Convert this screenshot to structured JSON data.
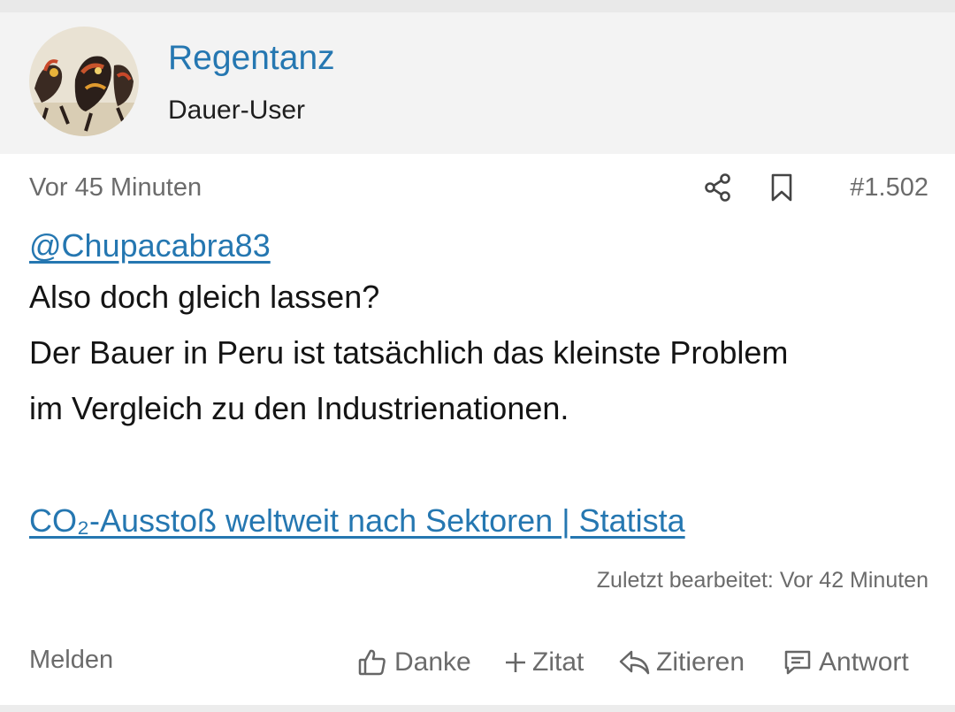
{
  "user": {
    "name": "Regentanz",
    "title": "Dauer-User"
  },
  "post": {
    "time": "Vor 45 Minuten",
    "number": "#1.502",
    "mention": "@Chupacabra83",
    "lines": [
      "Also doch gleich lassen?",
      "Der Bauer in Peru ist tatsächlich das kleinste Problem",
      "im Vergleich zu den Industrienationen."
    ],
    "link_text": "CO₂-Ausstoß weltweit nach Sektoren | Statista",
    "edited": "Zuletzt bearbeitet: Vor 42 Minuten"
  },
  "actions": {
    "report": "Melden",
    "like": "Danke",
    "quote_add": "Zitat",
    "quote": "Zitieren",
    "reply": "Antwort"
  },
  "icons": [
    "share-icon",
    "bookmark-icon",
    "thumbs-up-icon",
    "plus-icon",
    "reply-arrow-icon",
    "comment-icon"
  ],
  "colors": {
    "link": "#2577b1",
    "muted": "#6b6b6b",
    "header_bg": "#f3f3f3"
  }
}
